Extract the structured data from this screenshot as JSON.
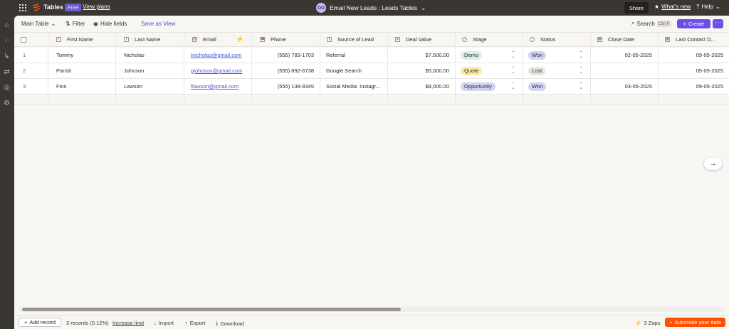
{
  "topbar": {
    "app_name": "Tables",
    "plan_badge": "Free",
    "view_plans": "View plans",
    "avatar_initials": "OO",
    "title": "Email New Leads : Leads Tables",
    "share": "Share",
    "whats_new": "What's new",
    "help": "Help"
  },
  "toolbar": {
    "view_name": "Main Table",
    "filter": "Filter",
    "hide_fields": "Hide fields",
    "save_as_view": "Save as View",
    "search": "Search",
    "search_shortcut": "Ctrl F",
    "create": "Create"
  },
  "columns": [
    {
      "label": "First Name",
      "icon": "text"
    },
    {
      "label": "Last Name",
      "icon": "text"
    },
    {
      "label": "Email",
      "icon": "email"
    },
    {
      "label": "Phone",
      "icon": "phone"
    },
    {
      "label": "Source of Lead",
      "icon": "text"
    },
    {
      "label": "Deal Value",
      "icon": "currency"
    },
    {
      "label": "Stage",
      "icon": "select"
    },
    {
      "label": "Status",
      "icon": "select"
    },
    {
      "label": "Close Date",
      "icon": "date"
    },
    {
      "label": "Last Contact D...",
      "icon": "date"
    }
  ],
  "rows": [
    {
      "num": "1",
      "first": "Tommy",
      "last": "Nicholas",
      "email": "tnicholas@gmail.com",
      "phone": "(555) 783-1703",
      "source": "Referral",
      "deal": "$7,500.00",
      "stage": "Demo",
      "status": "Won",
      "close": "02-05-2025",
      "last_contact": "09-05-2025"
    },
    {
      "num": "2",
      "first": "Parish",
      "last": "Johnson",
      "email": "pjohnson@gmail.com",
      "phone": "(555) 892-6738",
      "source": "Google Search",
      "deal": "$5,000.00",
      "stage": "Quote",
      "status": "Lost",
      "close": "",
      "last_contact": "05-05-2025"
    },
    {
      "num": "3",
      "first": "Finn",
      "last": "Lawson",
      "email": "flawson@gmail.com",
      "phone": "(555) 138-9345",
      "source": "Social Media: Instagr...",
      "deal": "$8,000.00",
      "stage": "Opportunity",
      "status": "Won",
      "close": "03-05-2025",
      "last_contact": "09-05-2025"
    }
  ],
  "stage_colors": {
    "Demo": "#d6f0e9",
    "Quote": "#fbeaa6",
    "Opportunity": "#d2d4f4"
  },
  "status_colors": {
    "Won": "#d2d4f4",
    "Lost": "#e6e4df"
  },
  "footer": {
    "add_record": "Add record",
    "records_count": "3 records (0.12%)",
    "increase_limit": "Increase limit",
    "import": "Import",
    "export": "Export",
    "download": "Download",
    "zaps": "3 Zaps",
    "automate": "Automate your data"
  },
  "colors": {
    "accent": "#6d4fe8",
    "orange": "#ff4f00",
    "chrome": "#3a3733"
  }
}
